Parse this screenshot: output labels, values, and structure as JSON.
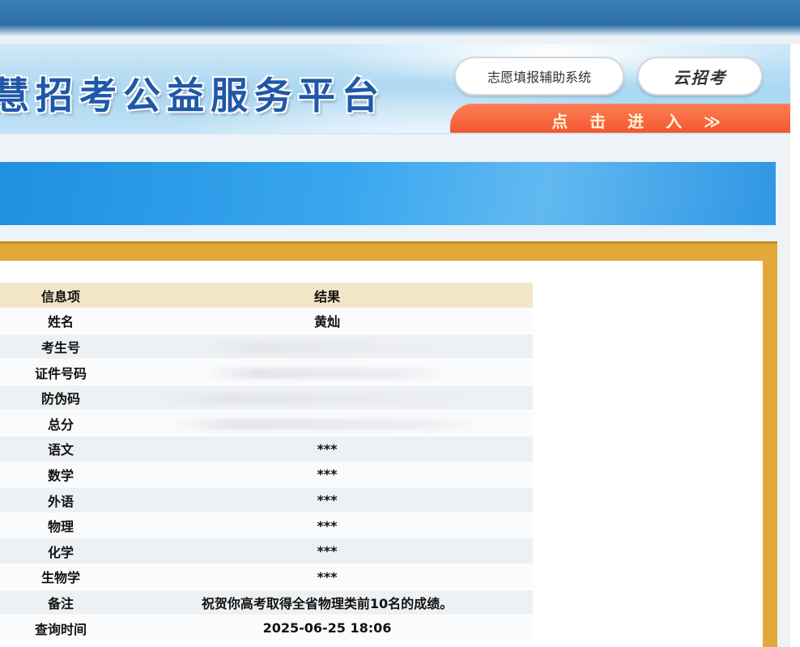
{
  "header": {
    "title": "慧招考公益服务平台",
    "zhiyuan_label": "志愿填报辅助系统",
    "yun_logo": "云招考",
    "enter_label": "点 击 进 入 ≫"
  },
  "table": {
    "head": {
      "key": "信息项",
      "value": "结果"
    },
    "rows": [
      {
        "key": "姓名",
        "value": "黄灿"
      },
      {
        "key": "考生号",
        "value": ""
      },
      {
        "key": "证件号码",
        "value": ""
      },
      {
        "key": "防伪码",
        "value": ""
      },
      {
        "key": "总分",
        "value": ""
      },
      {
        "key": "语文",
        "value": "***"
      },
      {
        "key": "数学",
        "value": "***"
      },
      {
        "key": "外语",
        "value": "***"
      },
      {
        "key": "物理",
        "value": "***"
      },
      {
        "key": "化学",
        "value": "***"
      },
      {
        "key": "生物学",
        "value": "***"
      },
      {
        "key": "备注",
        "value": "祝贺你高考取得全省物理类前10名的成绩。"
      },
      {
        "key": "查询时间",
        "value": "2025-06-25 18:06"
      }
    ]
  },
  "colors": {
    "top_strip": "#2f6fa8",
    "title_blue": "#1f58a8",
    "enter_orange": "#f0532e",
    "gold_frame": "#e2a93a",
    "table_head": "#f3e6c6"
  }
}
